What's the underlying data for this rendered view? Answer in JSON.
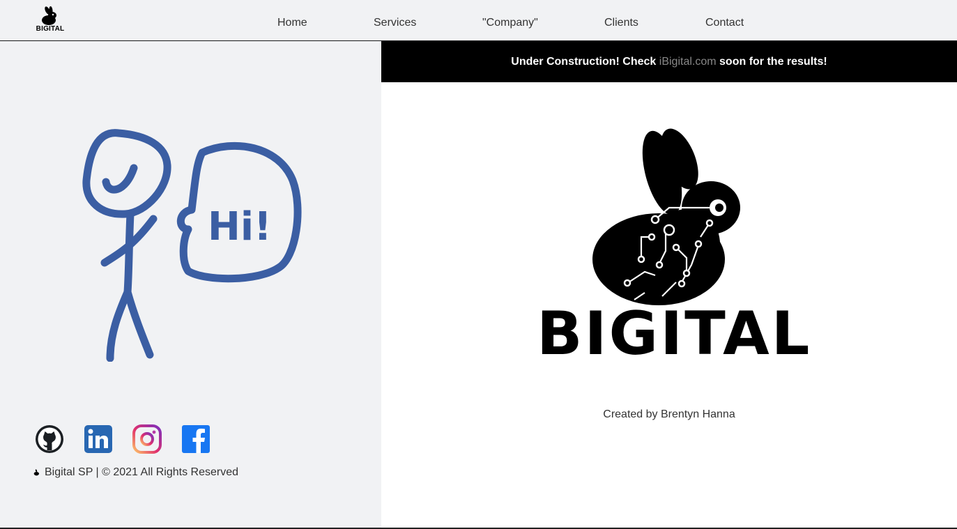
{
  "header": {
    "logo_text": "BIGITAL",
    "nav": [
      "Home",
      "Services",
      "\"Company\"",
      "Clients",
      "Contact"
    ]
  },
  "banner": {
    "prefix": "Under Construction! Check ",
    "link": "iBigital.com",
    "suffix": " soon for the results!"
  },
  "hero": {
    "speech_text": "Hi!",
    "brand": "BIGITAL",
    "credit": "Created by Brentyn Hanna"
  },
  "socials": [
    {
      "name": "github-icon"
    },
    {
      "name": "linkedin-icon"
    },
    {
      "name": "instagram-icon"
    },
    {
      "name": "facebook-icon"
    }
  ],
  "footer": {
    "copyright": "Bigital SP | © 2021 All Rights Reserved"
  },
  "colors": {
    "panel_bg": "#f1f2f4",
    "banner_bg": "#000000",
    "doodle_blue": "#3b5ea3",
    "link_gray": "#888888"
  }
}
